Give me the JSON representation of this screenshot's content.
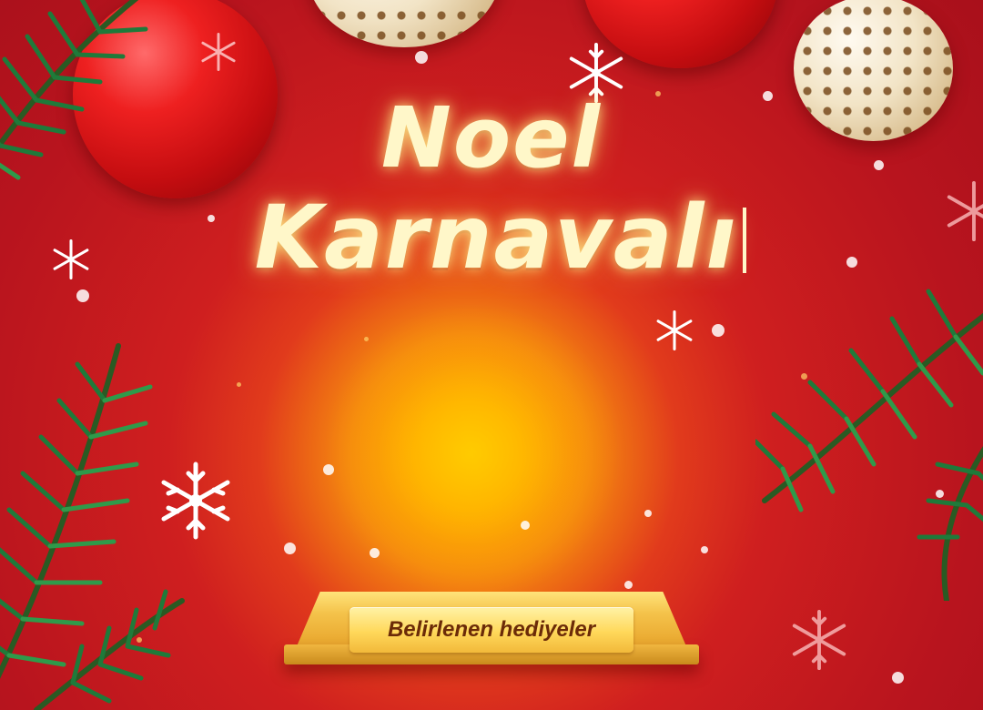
{
  "banner": {
    "title_line1": "Noel",
    "title_line2": "Karnavalı",
    "button_label": "Belirlenen hediyeler"
  },
  "colors": {
    "background": "#c8161f",
    "center_glow": "#ffc200",
    "title_text": "#fff7c9",
    "plaque_text": "#6b2b08",
    "branch_green": "#1f7a3a"
  },
  "decorations": {
    "ornaments": [
      "red-ornament-icon",
      "gold-dotted-ornament-icon"
    ],
    "branches": "pine-branch-icon",
    "snowflakes": "snowflake-icon"
  }
}
